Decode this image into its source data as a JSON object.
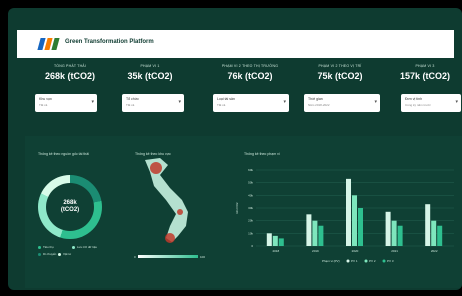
{
  "app": {
    "title": "Green Transformation Platform",
    "colors": {
      "bg": "#0e3b30",
      "accent": "#2ebf8f",
      "logo": [
        "#1565c0",
        "#f57c00",
        "#2e7d32"
      ]
    }
  },
  "kpis": [
    {
      "label": "TỔNG PHÁT THẢI",
      "value": "268k (tCO2)"
    },
    {
      "label": "PHẠM VI 1",
      "value": "35k (tCO2)"
    },
    {
      "label": "PHẠM VI 2 THEO THỊ TRƯỜNG",
      "value": "76k (tCO2)"
    },
    {
      "label": "PHẠM VI 2 THEO VỊ TRÍ",
      "value": "75k (tCO2)"
    },
    {
      "label": "PHẠM VI 3",
      "value": "157k (tCO2)"
    }
  ],
  "filters": [
    {
      "label": "Khu vực",
      "placeholder": "Tất cả"
    },
    {
      "label": "Tổ chức",
      "placeholder": "Tất cả"
    },
    {
      "label": "Loại tài sản",
      "placeholder": "Tất cả"
    },
    {
      "label": "Thời gian",
      "placeholder": "Năm 2018-2022"
    },
    {
      "label": "Đơn vị tính",
      "placeholder": "Cùng kỳ năm trước"
    }
  ],
  "panels": {
    "source": {
      "title": "Thống kê theo nguồn gốc tài thải",
      "center_value": "268k",
      "center_unit": "(tCO2)",
      "legend": [
        "Tiêu thụ",
        "Lưu trữ dữ liệu",
        "Di chuyển",
        "Vật tư"
      ]
    },
    "region": {
      "title": "Thống kê theo khu vực",
      "scale_min": "0",
      "scale_max": "100"
    },
    "scope": {
      "title": "Thống kê theo phạm vi",
      "ylabel": "tấn CO2"
    }
  },
  "chart_data": {
    "type": "bar",
    "title": "Thống kê theo phạm vi",
    "xlabel": "",
    "ylabel": "tấn CO2",
    "categories": [
      "2018",
      "2019",
      "2020",
      "2021",
      "2022"
    ],
    "y_ticks": [
      "0",
      "10k",
      "20k",
      "30k",
      "40k",
      "50k",
      "60k"
    ],
    "ylim": [
      0,
      60000
    ],
    "legend_title": "Phạm vi (PV)",
    "series": [
      {
        "name": "PV 1",
        "color": "#d7f5e8",
        "values": [
          10000,
          25000,
          53000,
          27000,
          33000
        ]
      },
      {
        "name": "PV 2",
        "color": "#7ee6bd",
        "values": [
          8000,
          20000,
          40000,
          20000,
          20000
        ]
      },
      {
        "name": "PV 3",
        "color": "#2ebf8f",
        "values": [
          6000,
          16000,
          30000,
          16000,
          16000
        ]
      }
    ],
    "grid": true,
    "legend_position": "bottom"
  }
}
